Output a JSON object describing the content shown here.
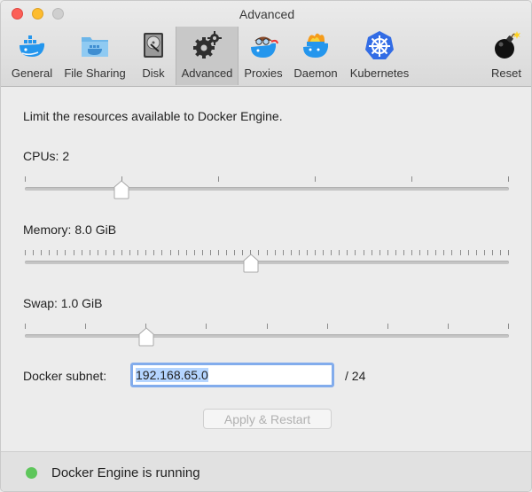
{
  "window": {
    "title": "Advanced"
  },
  "toolbar": {
    "items": [
      {
        "label": "General",
        "icon": "docker-whale-icon"
      },
      {
        "label": "File Sharing",
        "icon": "shared-folder-icon"
      },
      {
        "label": "Disk",
        "icon": "hard-disk-icon"
      },
      {
        "label": "Advanced",
        "icon": "gears-icon",
        "selected": true
      },
      {
        "label": "Proxies",
        "icon": "whale-aviator-icon"
      },
      {
        "label": "Daemon",
        "icon": "whale-fire-icon"
      },
      {
        "label": "Kubernetes",
        "icon": "kubernetes-helm-icon"
      },
      {
        "label": "Reset",
        "icon": "bomb-icon"
      }
    ]
  },
  "intro": "Limit the resources available to Docker Engine.",
  "cpus": {
    "label": "CPUs: 2",
    "value": 2,
    "min": 1,
    "max": 6
  },
  "memory": {
    "label": "Memory: 8.0 GiB",
    "value_gib": 8.0,
    "min_gib": 1,
    "max_gib": 16
  },
  "swap": {
    "label": "Swap: 1.0 GiB",
    "value_gib": 1.0,
    "min_gib": 0,
    "max_gib": 4
  },
  "subnet": {
    "label": "Docker subnet:",
    "value": "192.168.65.0",
    "suffix": "/ 24"
  },
  "apply_button": {
    "label": "Apply & Restart",
    "enabled": false
  },
  "status": {
    "text": "Docker Engine is running",
    "color": "#5ec65b"
  },
  "colors": {
    "accent_focus": "#82acec",
    "docker_blue": "#2496ed"
  }
}
